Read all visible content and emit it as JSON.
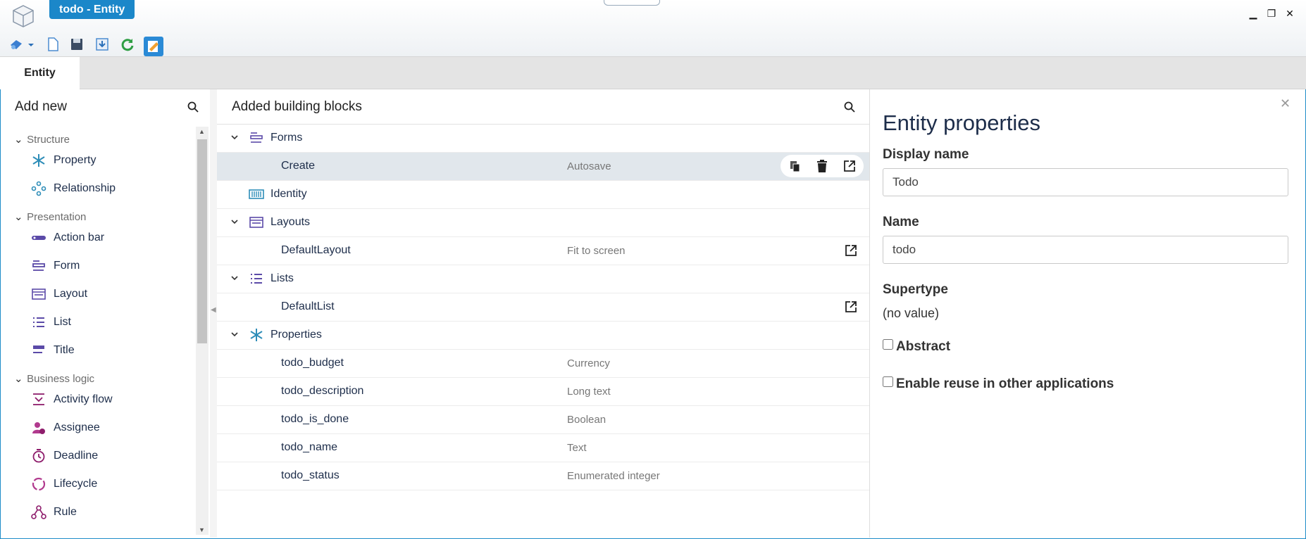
{
  "window": {
    "title": "todo - Entity"
  },
  "tabs": [
    {
      "label": "Entity"
    }
  ],
  "left_panel": {
    "title": "Add new",
    "sections": [
      {
        "label": "Structure",
        "items": [
          {
            "label": "Property",
            "icon": "asterisk-icon"
          },
          {
            "label": "Relationship",
            "icon": "relationship-icon"
          }
        ]
      },
      {
        "label": "Presentation",
        "items": [
          {
            "label": "Action bar",
            "icon": "action-bar-icon"
          },
          {
            "label": "Form",
            "icon": "form-icon"
          },
          {
            "label": "Layout",
            "icon": "layout-icon"
          },
          {
            "label": "List",
            "icon": "list-icon"
          },
          {
            "label": "Title",
            "icon": "title-icon"
          }
        ]
      },
      {
        "label": "Business logic",
        "items": [
          {
            "label": "Activity flow",
            "icon": "activity-flow-icon"
          },
          {
            "label": "Assignee",
            "icon": "assignee-icon"
          },
          {
            "label": "Deadline",
            "icon": "deadline-icon"
          },
          {
            "label": "Lifecycle",
            "icon": "lifecycle-icon"
          },
          {
            "label": "Rule",
            "icon": "rule-icon"
          }
        ]
      }
    ]
  },
  "middle_panel": {
    "title": "Added building blocks",
    "groups": {
      "forms": {
        "label": "Forms",
        "rows": [
          {
            "name": "Create",
            "type": "Autosave"
          }
        ]
      },
      "identity": {
        "label": "Identity"
      },
      "layouts": {
        "label": "Layouts",
        "rows": [
          {
            "name": "DefaultLayout",
            "type": "Fit to screen"
          }
        ]
      },
      "lists": {
        "label": "Lists",
        "rows": [
          {
            "name": "DefaultList",
            "type": ""
          }
        ]
      },
      "properties": {
        "label": "Properties",
        "rows": [
          {
            "name": "todo_budget",
            "type": "Currency"
          },
          {
            "name": "todo_description",
            "type": "Long text"
          },
          {
            "name": "todo_is_done",
            "type": "Boolean"
          },
          {
            "name": "todo_name",
            "type": "Text"
          },
          {
            "name": "todo_status",
            "type": "Enumerated integer"
          }
        ]
      }
    }
  },
  "right_panel": {
    "title": "Entity properties",
    "display_name_label": "Display name",
    "display_name_value": "Todo",
    "name_label": "Name",
    "name_value": "todo",
    "supertype_label": "Supertype",
    "supertype_value": "(no value)",
    "abstract_label": "Abstract",
    "reuse_label": "Enable reuse in other applications"
  },
  "colors": {
    "accent": "#1b87c9",
    "icon_purple": "#5b4aa8",
    "icon_teal": "#2e8db8",
    "icon_magenta": "#8e1d6c"
  }
}
